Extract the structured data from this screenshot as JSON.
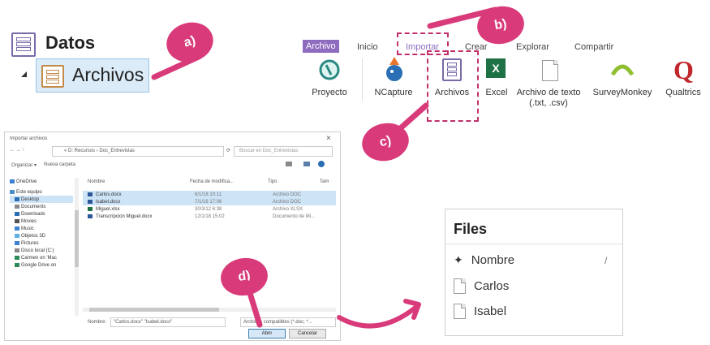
{
  "tree": {
    "root_label": "Datos",
    "child_label": "Archivos"
  },
  "callouts": {
    "a": "a)",
    "b": "b)",
    "c": "c)",
    "d": "d)"
  },
  "ribbon": {
    "tabs": [
      "Archivo",
      "Inicio",
      "Importar",
      "Crear",
      "Explorar",
      "Compartir"
    ],
    "buttons": [
      {
        "label": "Proyecto",
        "icon": "project-icon"
      },
      {
        "label": "NCapture",
        "icon": "ncapture-icon"
      },
      {
        "label": "Archivos",
        "icon": "files-icon"
      },
      {
        "label": "Excel",
        "icon": "excel-icon"
      },
      {
        "label": "Archivo de texto (.txt, .csv)",
        "icon": "text-file-icon"
      },
      {
        "label": "SurveyMonkey",
        "icon": "surveymonkey-icon"
      },
      {
        "label": "Qualtrics",
        "icon": "qualtrics-icon"
      }
    ]
  },
  "dialog": {
    "title": "Importar archivos",
    "close": "×",
    "path": "« D: Recursos › Doc_Entrevistas",
    "search_placeholder": "Buscar en Doc_Entrevistas",
    "organize": "Organizar ▾",
    "new_folder": "Nueva carpeta",
    "columns": [
      "Nombre",
      "Fecha de modifica...",
      "Tipo",
      "Tam"
    ],
    "sidebar": [
      "OneDrive",
      "Este equipo",
      "Desktop",
      "Documents",
      "Downloads",
      "Movies",
      "Music",
      "Objetos 3D",
      "Pictures",
      "Disco local (C:)",
      "Carmen on 'Mac",
      "Google Drive on"
    ],
    "files": [
      {
        "name": "Carlos.docx",
        "date": "6/1/18 10:11",
        "type": "Archivo DOC"
      },
      {
        "name": "Isabel.docx",
        "date": "7/1/18 17:06",
        "type": "Archivo DOC"
      },
      {
        "name": "Miguel.xlsx",
        "date": "30/3/12 6:38",
        "type": "Archivo XLSX"
      },
      {
        "name": "Transcripcion Miguel.docx",
        "date": "12/1/18 15:02",
        "type": "Documento de Mi..."
      }
    ],
    "filename_label": "Nombre:",
    "filename_value": "\"Carlos.docx\" \"Isabel.docx\"",
    "filter_value": "Archivos compatibles (*.doc; *...",
    "open_button": "Abrir",
    "cancel_button": "Cancelar"
  },
  "files_panel": {
    "title": "Files",
    "header": "Nombre",
    "rows": [
      "Carlos",
      "Isabel"
    ]
  },
  "colors": {
    "accent_pink": "#d83a7a",
    "tab_purple": "#8e6bbf",
    "selection_blue": "#cde3f6"
  }
}
